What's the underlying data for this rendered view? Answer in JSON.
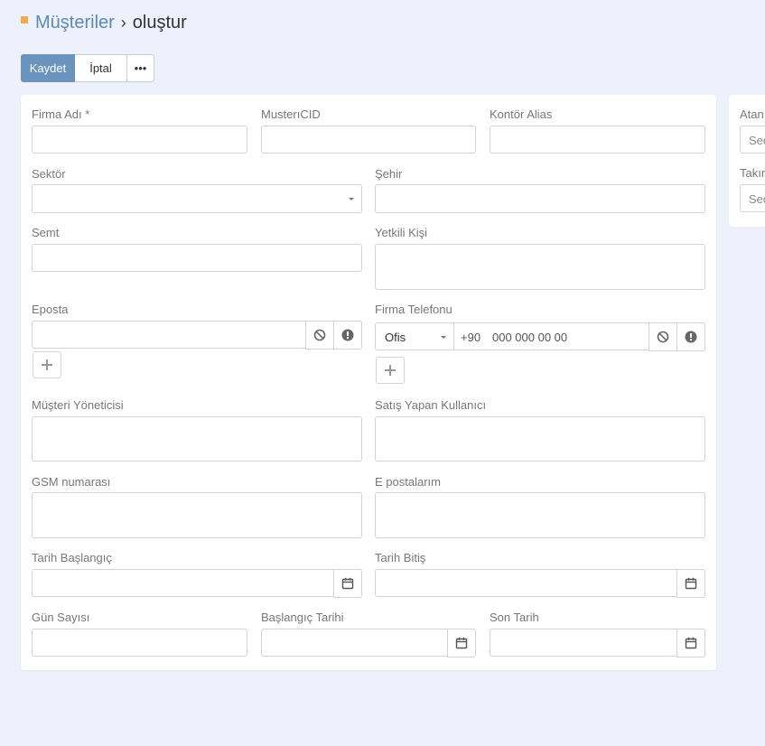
{
  "breadcrumb": {
    "parent": "Müşteriler",
    "separator": "›",
    "current": "oluştur"
  },
  "toolbar": {
    "save_label": "Kaydet",
    "cancel_label": "İptal",
    "more_label": "•••"
  },
  "form": {
    "firma_adi": {
      "label": "Firma Adı *"
    },
    "musteri_cid": {
      "label": "MusterıCID"
    },
    "kontor_alias": {
      "label": "Kontör Alias"
    },
    "sektor": {
      "label": "Sektör",
      "value": ""
    },
    "sehir": {
      "label": "Şehir"
    },
    "semt": {
      "label": "Semt"
    },
    "yetkili_kisi": {
      "label": "Yetkili Kişi"
    },
    "eposta": {
      "label": "Eposta"
    },
    "firma_telefonu": {
      "label": "Firma Telefonu",
      "type_value": "Ofis",
      "prefix": "+90",
      "placeholder": "000 000 00 00"
    },
    "musteri_yoneticisi": {
      "label": "Müşteri Yöneticisi"
    },
    "satis_yapan": {
      "label": "Satış Yapan Kullanıcı"
    },
    "gsm": {
      "label": "GSM numarası"
    },
    "e_postalarim": {
      "label": "E postalarım"
    },
    "tarih_baslangic": {
      "label": "Tarih Başlangıç"
    },
    "tarih_bitis": {
      "label": "Tarih Bitiş"
    },
    "gun_sayisi": {
      "label": "Gün Sayısı"
    },
    "baslangic_tarihi": {
      "label": "Başlangıç Tarihi"
    },
    "son_tarih": {
      "label": "Son Tarih"
    }
  },
  "side": {
    "atanan": {
      "label": "Atan",
      "placeholder": "Seç"
    },
    "takim": {
      "label": "Takır",
      "placeholder": "Seç"
    }
  },
  "colors": {
    "accent": "#6a93bd",
    "breadcrumb_link": "#5a8ab5",
    "marker": "#f0ad4e",
    "background": "#eef0fb"
  },
  "icons": {
    "clear": "ban-icon",
    "info": "exclamation-circle-icon",
    "add": "plus-icon",
    "date": "calendar-icon",
    "dropdown": "caret-down-icon"
  }
}
